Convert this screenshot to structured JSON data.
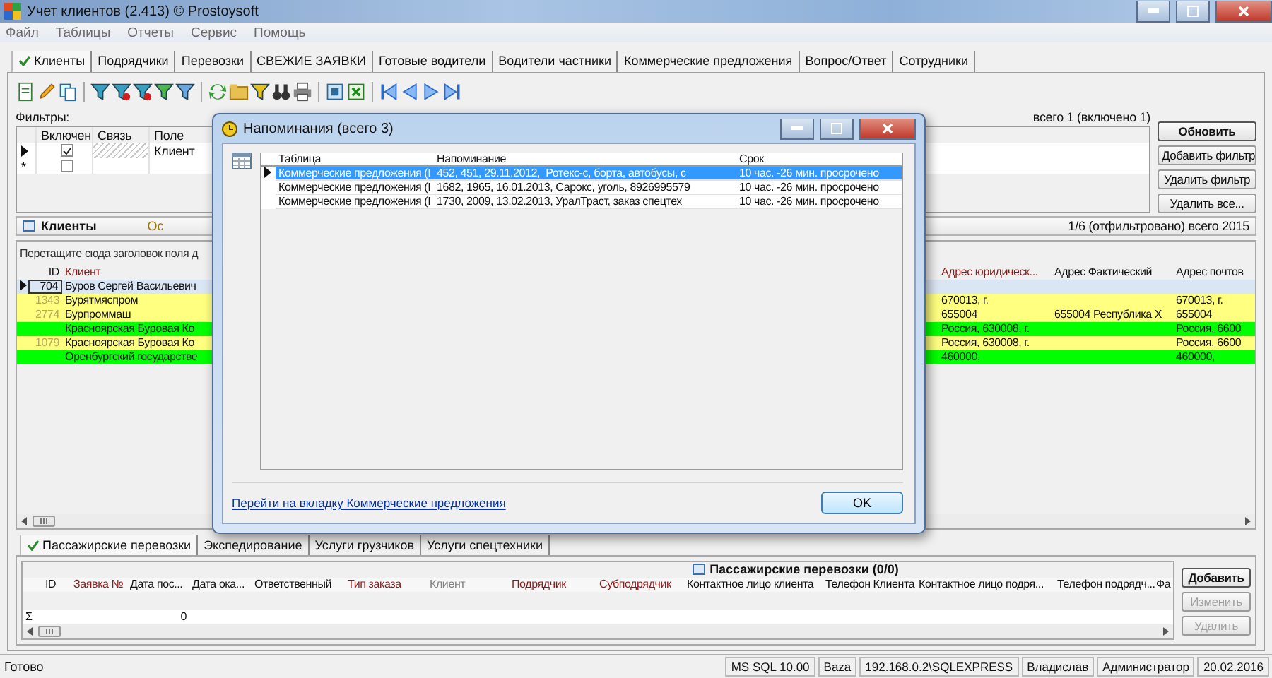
{
  "window": {
    "title": "Учет клиентов (2.413) © Prostoysoft"
  },
  "menu": [
    "Файл",
    "Таблицы",
    "Отчеты",
    "Сервис",
    "Помощь"
  ],
  "tabs": [
    {
      "label": "Клиенты",
      "selected": true
    },
    {
      "label": "Подрядчики",
      "selected": false
    },
    {
      "label": "Перевозки",
      "selected": false
    },
    {
      "label": "СВЕЖИЕ ЗАЯВКИ",
      "selected": false
    },
    {
      "label": "Готовые водители",
      "selected": false
    },
    {
      "label": "Водители частники",
      "selected": false
    },
    {
      "label": "Коммерческие предложения",
      "selected": false
    },
    {
      "label": "Вопрос/Ответ",
      "selected": false
    },
    {
      "label": "Сотрудники",
      "selected": false
    }
  ],
  "filters": {
    "label": "Фильтры:",
    "summary": "всего 1 (включено 1)",
    "columns": [
      "Включен",
      "Связь",
      "Поле"
    ],
    "rows": [
      {
        "kind": "current",
        "checked": true,
        "field": "Клиент"
      },
      {
        "kind": "new",
        "marker": "*",
        "checked": false
      }
    ],
    "buttons": [
      {
        "label": "Обновить",
        "default": true
      },
      {
        "label": "Добавить фильтр",
        "default": false
      },
      {
        "label": "Удалить фильтр",
        "default": false
      },
      {
        "label": "Удалить все...",
        "default": false
      }
    ]
  },
  "clients": {
    "title": "Клиенты",
    "title_extra": "Ос",
    "summary": "1/6 (отфильтровано) всего 2015",
    "group_hint": "Перетащите сюда заголовок поля д",
    "columns": [
      {
        "label": "ID",
        "kind": "plain"
      },
      {
        "label": "Клиент",
        "kind": "required"
      }
    ],
    "right_columns": [
      {
        "label": "Адрес юридическ...",
        "kind": "required"
      },
      {
        "label": "Адрес Фактический",
        "kind": "plain"
      },
      {
        "label": "Адрес почтов",
        "kind": "plain"
      }
    ],
    "rows": [
      {
        "id": "704",
        "name": "Буров Сергей Васильевич",
        "selected": true,
        "color": "#dbe6f4"
      },
      {
        "id": "1343",
        "name": "Бурятмяспром",
        "selected": false,
        "color": "#ffff80",
        "address_legal": "670013, г.",
        "address_postal": "670013, г."
      },
      {
        "id": "2774",
        "name": "Бурпроммаш",
        "selected": false,
        "color": "#ffff80",
        "address_legal": "655004",
        "address_actual": "655004 Республика Х",
        "address_postal": "655004"
      },
      {
        "name": "Красноярская Буровая Ко",
        "selected": false,
        "color": "#00ff00",
        "address_legal": "Россия, 630008, г.",
        "address_postal": "Россия, 6600"
      },
      {
        "id": "1079",
        "name": "Красноярская Буровая Ко",
        "selected": false,
        "color": "#ffff80",
        "address_legal": "Россия, 630008, г.",
        "address_postal": "Россия, 6600"
      },
      {
        "name": "Оренбургский государстве",
        "selected": false,
        "color": "#00ff00",
        "address_legal": "460000,",
        "address_postal": "460000,"
      }
    ]
  },
  "bottom": {
    "tabs": [
      {
        "label": "Пассажирские перевозки",
        "selected": true
      },
      {
        "label": "Экспедирование",
        "selected": false
      },
      {
        "label": "Услуги грузчиков",
        "selected": false
      },
      {
        "label": "Услуги спецтехники",
        "selected": false
      }
    ],
    "title": "Пассажирские перевозки (0/0)",
    "columns": [
      {
        "label": "ID",
        "kind": "plain"
      },
      {
        "label": "Заявка №",
        "kind": "required"
      },
      {
        "label": "Дата пос...",
        "kind": "plain"
      },
      {
        "label": "Дата ока...",
        "kind": "plain"
      },
      {
        "label": "Ответственный",
        "kind": "plain"
      },
      {
        "label": "Тип заказа",
        "kind": "required"
      },
      {
        "label": "Клиент",
        "kind": "muted"
      },
      {
        "label": "Подрядчик",
        "kind": "required"
      },
      {
        "label": "Субподрядчик",
        "kind": "required"
      },
      {
        "label": "Контактное лицо клиента",
        "kind": "plain"
      },
      {
        "label": "Телефон Клиента",
        "kind": "plain"
      },
      {
        "label": "Контактное лицо подря...",
        "kind": "plain"
      },
      {
        "label": "Телефон подрядч...",
        "kind": "plain"
      },
      {
        "label": "Фа",
        "kind": "plain"
      }
    ],
    "sum_symbol": "Σ",
    "sum_value": "0",
    "buttons": [
      {
        "label": "Добавить",
        "disabled": false
      },
      {
        "label": "Изменить",
        "disabled": true
      },
      {
        "label": "Удалить",
        "disabled": true
      }
    ]
  },
  "status_bar": {
    "text": "Готово",
    "panes": [
      "MS SQL 10.00",
      "Baza",
      "192.168.0.2\\SQLEXPRESS",
      "Владислав",
      "Администратор",
      "20.02.2016"
    ]
  },
  "dialog": {
    "title": "Напоминания (всего 3)",
    "columns": [
      "Таблица",
      "Напоминание",
      "Срок"
    ],
    "rows": [
      {
        "table": "Коммерческие предложения (I",
        "text": "452, 451, 29.11.2012,  Ротекс-с, борта, автобусы, с",
        "due": "10 час. -26 мин. просрочено",
        "selected": true
      },
      {
        "table": "Коммерческие предложения (I",
        "text": "1682, 1965, 16.01.2013, Сарокс, уголь, 8926995579",
        "due": "10 час. -26 мин. просрочено",
        "selected": false
      },
      {
        "table": "Коммерческие предложения (I",
        "text": "1730, 2009, 13.02.2013, УралТраст, заказ спецтех",
        "due": "10 час. -26 мин. просрочено",
        "selected": false
      }
    ],
    "link": "Перейти на вкладку Коммерческие предложения",
    "ok": "OK"
  }
}
